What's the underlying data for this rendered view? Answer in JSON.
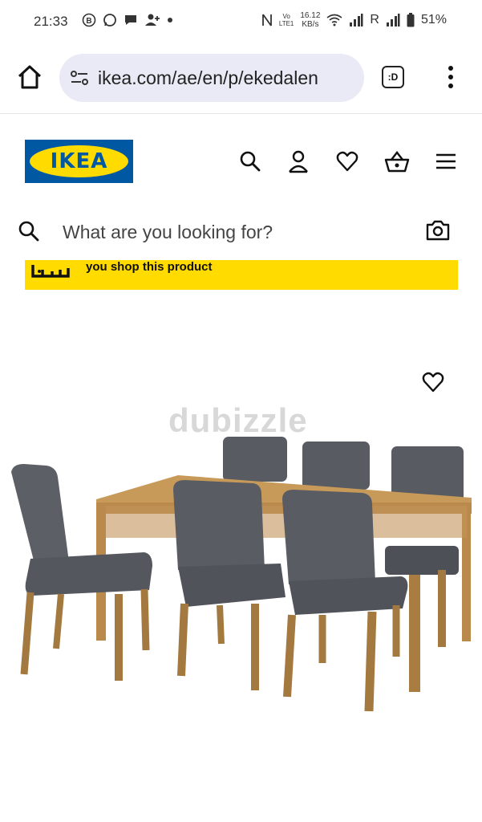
{
  "status_bar": {
    "time": "21:33",
    "net_speed_value": "16.12",
    "net_speed_unit": "KB/s",
    "sim_label": "R",
    "lte_label": "LTE1",
    "volte_label": "Vo",
    "battery": "51%",
    "left_icons": [
      "b-badge-icon",
      "whatsapp-icon",
      "message-icon",
      "person-add-icon",
      "dot-icon"
    ]
  },
  "browser": {
    "url": "ikea.com/ae/en/p/ekedalen",
    "tab_label": ":D"
  },
  "header": {
    "logo_text": "IKEA",
    "brand_blue": "#0058a3",
    "brand_yellow": "#ffdb00"
  },
  "search": {
    "placeholder": "What are you looking for?"
  },
  "banner": {
    "text": "you shop this product"
  },
  "watermark": {
    "text": "dubizzle"
  }
}
